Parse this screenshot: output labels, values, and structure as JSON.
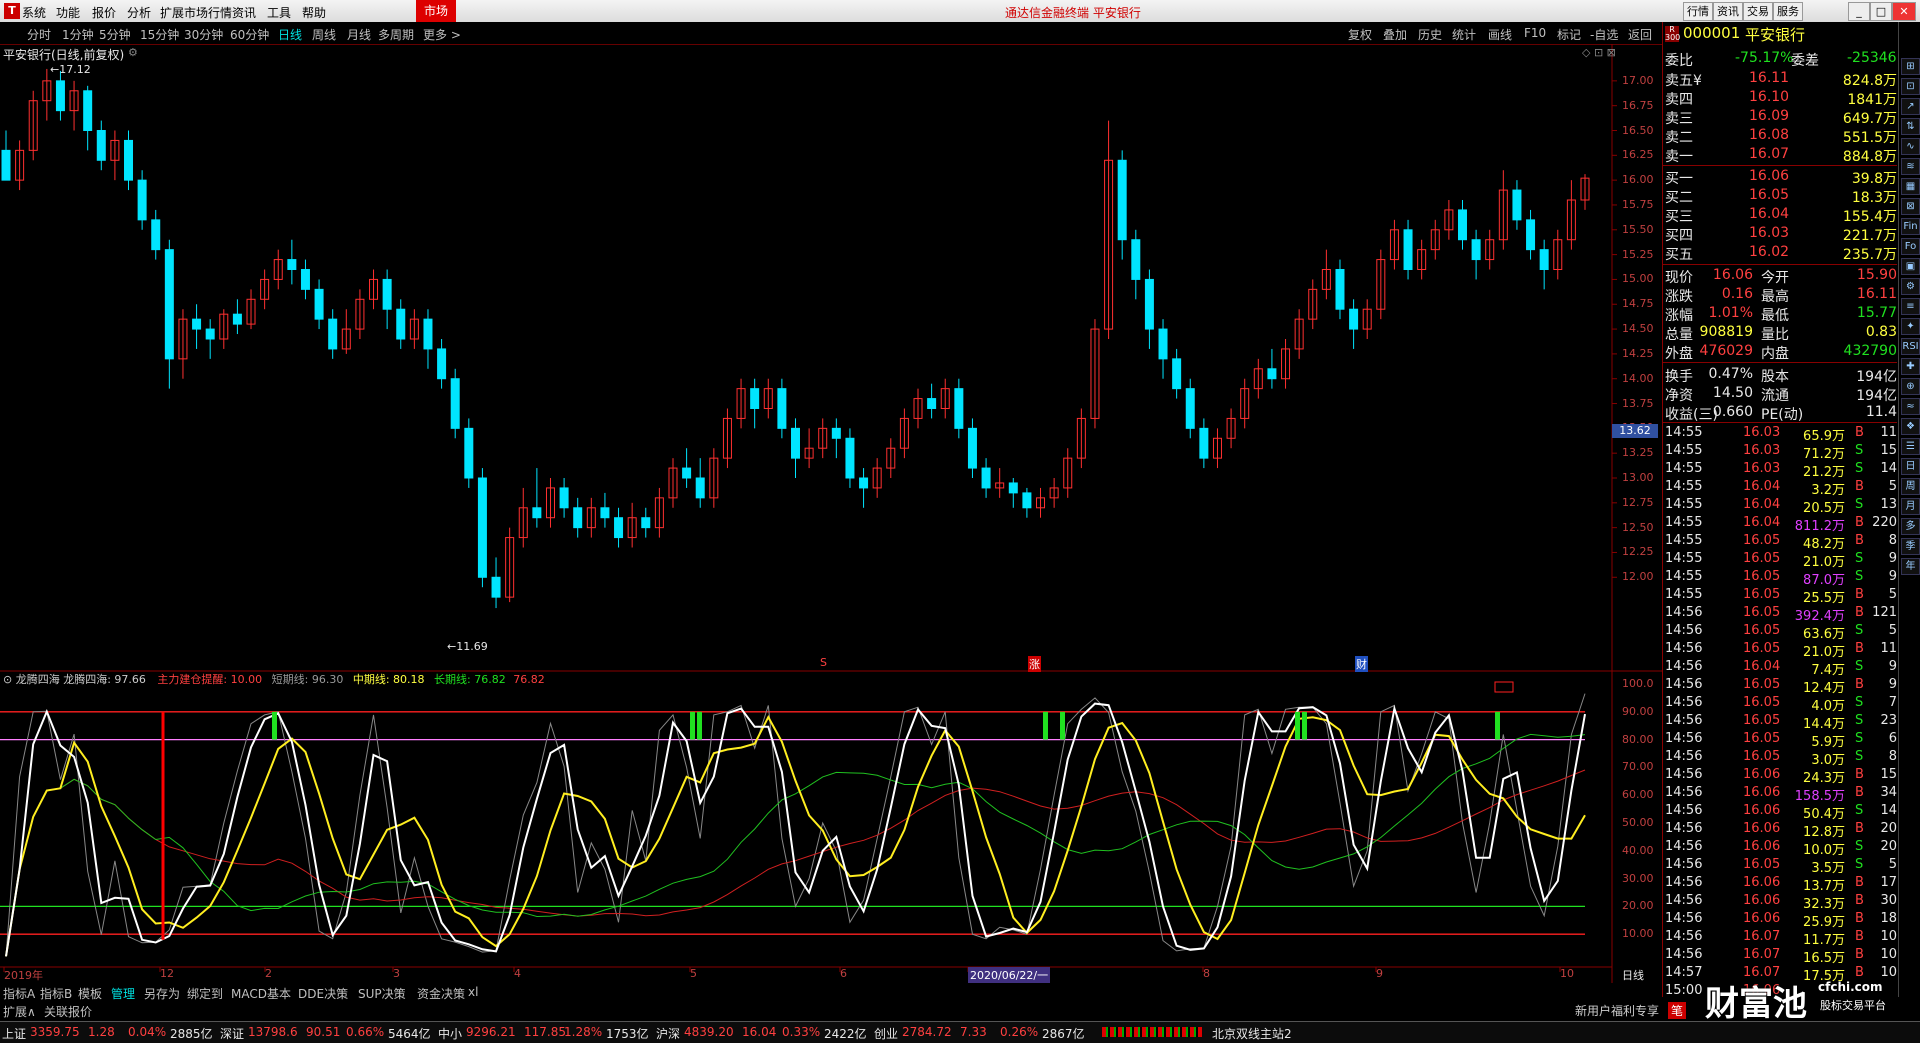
{
  "menu": {
    "items": [
      "系统",
      "功能",
      "报价",
      "分析",
      "扩展市场行情",
      "资讯",
      "工具",
      "帮助"
    ],
    "market": "市场",
    "title": "通达信金融终端  平安银行",
    "right_btns": [
      "行情",
      "资讯",
      "交易",
      "服务"
    ]
  },
  "periods": {
    "items": [
      "分时",
      "1分钟",
      "5分钟",
      "15分钟",
      "30分钟",
      "60分钟",
      "日线",
      "周线",
      "月线",
      "多周期",
      "更多 >"
    ],
    "active_index": 6
  },
  "tools": [
    "复权",
    "叠加",
    "历史",
    "统计",
    "画线",
    "F10",
    "标记",
    "-自选",
    "返回"
  ],
  "chart": {
    "title": "平安银行(日线,前复权)",
    "price_axis": [
      "17.00",
      "16.75",
      "16.50",
      "16.25",
      "16.00",
      "15.75",
      "15.50",
      "15.25",
      "15.00",
      "14.75",
      "14.50",
      "14.25",
      "14.00",
      "13.75",
      "13.50",
      "13.25",
      "13.00",
      "12.75",
      "12.50",
      "12.25",
      "12.00"
    ],
    "high_marker": "17.12",
    "low_marker": "11.69",
    "cursor_price": "13.62",
    "event_marks": [
      "S",
      "涨",
      "财"
    ],
    "candles": [
      [
        16.3,
        16.0,
        16.5,
        16.0
      ],
      [
        16.0,
        16.3,
        16.4,
        15.9
      ],
      [
        16.3,
        16.8,
        16.9,
        16.2
      ],
      [
        16.8,
        17.0,
        17.12,
        16.6
      ],
      [
        17.0,
        16.7,
        17.1,
        16.6
      ],
      [
        16.7,
        16.9,
        17.0,
        16.5
      ],
      [
        16.9,
        16.5,
        16.95,
        16.3
      ],
      [
        16.5,
        16.2,
        16.6,
        16.1
      ],
      [
        16.2,
        16.4,
        16.5,
        16.0
      ],
      [
        16.4,
        16.0,
        16.5,
        15.9
      ],
      [
        16.0,
        15.6,
        16.1,
        15.5
      ],
      [
        15.6,
        15.3,
        15.7,
        15.2
      ],
      [
        15.3,
        14.2,
        15.4,
        13.9
      ],
      [
        14.2,
        14.6,
        14.7,
        14.0
      ],
      [
        14.6,
        14.5,
        14.75,
        14.3
      ],
      [
        14.5,
        14.4,
        14.6,
        14.2
      ],
      [
        14.4,
        14.65,
        14.7,
        14.3
      ],
      [
        14.65,
        14.55,
        14.8,
        14.45
      ],
      [
        14.55,
        14.8,
        14.9,
        14.5
      ],
      [
        14.8,
        15.0,
        15.1,
        14.7
      ],
      [
        15.0,
        15.2,
        15.3,
        14.9
      ],
      [
        15.2,
        15.1,
        15.4,
        14.95
      ],
      [
        15.1,
        14.9,
        15.2,
        14.8
      ],
      [
        14.9,
        14.6,
        15.0,
        14.5
      ],
      [
        14.6,
        14.3,
        14.7,
        14.2
      ],
      [
        14.3,
        14.5,
        14.7,
        14.25
      ],
      [
        14.5,
        14.8,
        14.9,
        14.4
      ],
      [
        14.8,
        15.0,
        15.1,
        14.7
      ],
      [
        15.0,
        14.7,
        15.1,
        14.5
      ],
      [
        14.7,
        14.4,
        14.8,
        14.3
      ],
      [
        14.4,
        14.6,
        14.7,
        14.3
      ],
      [
        14.6,
        14.3,
        14.7,
        14.1
      ],
      [
        14.3,
        14.0,
        14.4,
        13.9
      ],
      [
        14.0,
        13.5,
        14.1,
        13.4
      ],
      [
        13.5,
        13.0,
        13.6,
        12.9
      ],
      [
        13.0,
        12.0,
        13.1,
        11.9
      ],
      [
        12.0,
        11.8,
        12.2,
        11.69
      ],
      [
        11.8,
        12.4,
        12.5,
        11.75
      ],
      [
        12.4,
        12.7,
        12.9,
        12.3
      ],
      [
        12.7,
        12.6,
        13.1,
        12.5
      ],
      [
        12.6,
        12.9,
        13.0,
        12.5
      ],
      [
        12.9,
        12.7,
        13.0,
        12.6
      ],
      [
        12.7,
        12.5,
        12.8,
        12.4
      ],
      [
        12.5,
        12.7,
        12.8,
        12.4
      ],
      [
        12.7,
        12.6,
        12.85,
        12.5
      ],
      [
        12.6,
        12.4,
        12.7,
        12.3
      ],
      [
        12.4,
        12.6,
        12.75,
        12.3
      ],
      [
        12.6,
        12.5,
        12.7,
        12.4
      ],
      [
        12.5,
        12.8,
        12.9,
        12.4
      ],
      [
        12.8,
        13.1,
        13.2,
        12.7
      ],
      [
        13.1,
        13.0,
        13.3,
        12.9
      ],
      [
        13.0,
        12.8,
        13.2,
        12.7
      ],
      [
        12.8,
        13.2,
        13.3,
        12.7
      ],
      [
        13.2,
        13.6,
        13.7,
        13.1
      ],
      [
        13.6,
        13.9,
        14.0,
        13.5
      ],
      [
        13.9,
        13.7,
        14.0,
        13.5
      ],
      [
        13.7,
        13.9,
        14.0,
        13.6
      ],
      [
        13.9,
        13.5,
        14.0,
        13.4
      ],
      [
        13.5,
        13.2,
        13.6,
        13.0
      ],
      [
        13.2,
        13.3,
        13.5,
        13.1
      ],
      [
        13.3,
        13.5,
        13.6,
        13.2
      ],
      [
        13.5,
        13.4,
        13.6,
        13.2
      ],
      [
        13.4,
        13.0,
        13.5,
        12.9
      ],
      [
        13.0,
        12.9,
        13.1,
        12.7
      ],
      [
        12.9,
        13.1,
        13.2,
        12.8
      ],
      [
        13.1,
        13.3,
        13.4,
        13.0
      ],
      [
        13.3,
        13.6,
        13.7,
        13.2
      ],
      [
        13.6,
        13.8,
        13.9,
        13.5
      ],
      [
        13.8,
        13.7,
        13.95,
        13.6
      ],
      [
        13.7,
        13.9,
        14.0,
        13.6
      ],
      [
        13.9,
        13.5,
        14.0,
        13.4
      ],
      [
        13.5,
        13.1,
        13.6,
        13.0
      ],
      [
        13.1,
        12.9,
        13.2,
        12.8
      ],
      [
        12.9,
        12.95,
        13.1,
        12.8
      ],
      [
        12.95,
        12.85,
        13.0,
        12.7
      ],
      [
        12.85,
        12.7,
        12.9,
        12.6
      ],
      [
        12.7,
        12.8,
        12.9,
        12.6
      ],
      [
        12.8,
        12.9,
        13.0,
        12.7
      ],
      [
        12.9,
        13.2,
        13.3,
        12.8
      ],
      [
        13.2,
        13.6,
        13.7,
        13.1
      ],
      [
        13.6,
        14.5,
        14.6,
        13.5
      ],
      [
        14.5,
        16.2,
        16.6,
        14.4
      ],
      [
        16.2,
        15.4,
        16.3,
        15.2
      ],
      [
        15.4,
        15.0,
        15.5,
        14.8
      ],
      [
        15.0,
        14.5,
        15.1,
        14.3
      ],
      [
        14.5,
        14.2,
        14.6,
        14.0
      ],
      [
        14.2,
        13.9,
        14.3,
        13.8
      ],
      [
        13.9,
        13.5,
        14.0,
        13.4
      ],
      [
        13.5,
        13.2,
        13.6,
        13.1
      ],
      [
        13.2,
        13.4,
        13.5,
        13.1
      ],
      [
        13.4,
        13.6,
        13.7,
        13.3
      ],
      [
        13.6,
        13.9,
        14.0,
        13.5
      ],
      [
        13.9,
        14.1,
        14.2,
        13.8
      ],
      [
        14.1,
        14.0,
        14.3,
        13.9
      ],
      [
        14.0,
        14.3,
        14.4,
        13.9
      ],
      [
        14.3,
        14.6,
        14.7,
        14.2
      ],
      [
        14.6,
        14.9,
        15.0,
        14.5
      ],
      [
        14.9,
        15.1,
        15.3,
        14.8
      ],
      [
        15.1,
        14.7,
        15.2,
        14.6
      ],
      [
        14.7,
        14.5,
        14.8,
        14.3
      ],
      [
        14.5,
        14.7,
        14.8,
        14.4
      ],
      [
        14.7,
        15.2,
        15.3,
        14.6
      ],
      [
        15.2,
        15.5,
        15.6,
        15.1
      ],
      [
        15.5,
        15.1,
        15.6,
        15.0
      ],
      [
        15.1,
        15.3,
        15.4,
        15.0
      ],
      [
        15.3,
        15.5,
        15.6,
        15.2
      ],
      [
        15.5,
        15.7,
        15.8,
        15.4
      ],
      [
        15.7,
        15.4,
        15.8,
        15.3
      ],
      [
        15.4,
        15.2,
        15.5,
        15.0
      ],
      [
        15.2,
        15.4,
        15.5,
        15.1
      ],
      [
        15.4,
        15.9,
        16.1,
        15.3
      ],
      [
        15.9,
        15.6,
        16.0,
        15.5
      ],
      [
        15.6,
        15.3,
        15.7,
        15.2
      ],
      [
        15.3,
        15.1,
        15.4,
        14.9
      ],
      [
        15.1,
        15.4,
        15.5,
        15.0
      ],
      [
        15.4,
        15.8,
        16.0,
        15.3
      ],
      [
        15.8,
        16.02,
        16.06,
        15.7
      ]
    ],
    "indicator": {
      "name": "龙腾四海",
      "value_label": "龙腾四海: 97.66",
      "main_label": "主力建仓提醒: 10.00",
      "short_label": "短期线: 96.30",
      "mid_label": "中期线: 80.18",
      "long_label": "长期线: 76.82",
      "long_label2": "76.82",
      "axis": [
        "100.0",
        "90.00",
        "80.00",
        "70.00",
        "60.00",
        "50.00",
        "40.00",
        "30.00",
        "20.00",
        "10.00"
      ],
      "refs": [
        90,
        80,
        20,
        10
      ]
    },
    "time_axis": [
      "2019年",
      "12",
      "2",
      "3",
      "4",
      "5",
      "6",
      "2020/06/22/一",
      "8",
      "9",
      "10"
    ],
    "period_label": "日线"
  },
  "quote": {
    "code": "000001",
    "name": "平安银行",
    "badge": "R 300",
    "wb_label": "委比",
    "wb": "-75.17%",
    "wc_label": "委差",
    "wc": "-25346",
    "asks": [
      [
        "卖五¥",
        "16.11",
        "824.8万"
      ],
      [
        "卖四",
        "16.10",
        "1841万"
      ],
      [
        "卖三",
        "16.09",
        "649.7万"
      ],
      [
        "卖二",
        "16.08",
        "551.5万"
      ],
      [
        "卖一",
        "16.07",
        "884.8万"
      ]
    ],
    "bids": [
      [
        "买一",
        "16.06",
        "39.8万"
      ],
      [
        "买二",
        "16.05",
        "18.3万"
      ],
      [
        "买三",
        "16.04",
        "155.4万"
      ],
      [
        "买四",
        "16.03",
        "221.7万"
      ],
      [
        "买五",
        "16.02",
        "235.7万"
      ]
    ],
    "stats": [
      [
        "现价",
        "16.06",
        "今开",
        "15.90"
      ],
      [
        "涨跌",
        "0.16",
        "最高",
        "16.11"
      ],
      [
        "涨幅",
        "1.01%",
        "最低",
        "15.77"
      ],
      [
        "总量",
        "908819",
        "量比",
        "0.83"
      ],
      [
        "外盘",
        "476029",
        "内盘",
        "432790"
      ],
      [
        "换手",
        "0.47%",
        "股本",
        "194亿"
      ],
      [
        "净资",
        "14.50",
        "流通",
        "194亿"
      ],
      [
        "收益(三)",
        "0.660",
        "PE(动)",
        "11.4"
      ]
    ],
    "ticks": [
      [
        "14:55",
        "16.03",
        "65.9万",
        "B",
        "11"
      ],
      [
        "14:55",
        "16.03",
        "71.2万",
        "S",
        "15"
      ],
      [
        "14:55",
        "16.03",
        "21.2万",
        "S",
        "14"
      ],
      [
        "14:55",
        "16.04",
        "3.2万",
        "B",
        "5"
      ],
      [
        "14:55",
        "16.04",
        "20.5万",
        "S",
        "13"
      ],
      [
        "14:55",
        "16.04",
        "811.2万",
        "B",
        "220"
      ],
      [
        "14:55",
        "16.05",
        "48.2万",
        "B",
        "8"
      ],
      [
        "14:55",
        "16.05",
        "21.0万",
        "S",
        "9"
      ],
      [
        "14:55",
        "16.05",
        "87.0万",
        "S",
        "9"
      ],
      [
        "14:55",
        "16.05",
        "25.5万",
        "B",
        "5"
      ],
      [
        "14:56",
        "16.05",
        "392.4万",
        "B",
        "121"
      ],
      [
        "14:56",
        "16.05",
        "63.6万",
        "S",
        "5"
      ],
      [
        "14:56",
        "16.05",
        "21.0万",
        "B",
        "11"
      ],
      [
        "14:56",
        "16.04",
        "7.4万",
        "S",
        "9"
      ],
      [
        "14:56",
        "16.05",
        "12.4万",
        "B",
        "9"
      ],
      [
        "14:56",
        "16.05",
        "4.0万",
        "S",
        "7"
      ],
      [
        "14:56",
        "16.05",
        "14.4万",
        "S",
        "23"
      ],
      [
        "14:56",
        "16.05",
        "5.9万",
        "S",
        "6"
      ],
      [
        "14:56",
        "16.05",
        "3.0万",
        "S",
        "8"
      ],
      [
        "14:56",
        "16.06",
        "24.3万",
        "B",
        "15"
      ],
      [
        "14:56",
        "16.06",
        "158.5万",
        "B",
        "34"
      ],
      [
        "14:56",
        "16.06",
        "50.4万",
        "S",
        "14"
      ],
      [
        "14:56",
        "16.06",
        "12.8万",
        "B",
        "20"
      ],
      [
        "14:56",
        "16.06",
        "10.0万",
        "S",
        "20"
      ],
      [
        "14:56",
        "16.05",
        "3.5万",
        "S",
        "5"
      ],
      [
        "14:56",
        "16.06",
        "13.7万",
        "B",
        "17"
      ],
      [
        "14:56",
        "16.06",
        "32.3万",
        "B",
        "30"
      ],
      [
        "14:56",
        "16.06",
        "25.9万",
        "B",
        "18"
      ],
      [
        "14:56",
        "16.07",
        "11.7万",
        "B",
        "10"
      ],
      [
        "14:56",
        "16.07",
        "16.5万",
        "B",
        "10"
      ],
      [
        "14:57",
        "16.07",
        "17.5万",
        "B",
        "10"
      ],
      [
        "15:00",
        "16.06",
        "",
        "",
        ""
      ]
    ]
  },
  "sidebar_icons": [
    "⊞",
    "⊡",
    "↗",
    "⇅",
    "∿",
    "≋",
    "▦",
    "⊠",
    "Fin",
    "Fo",
    "▣",
    "⚙",
    "≡",
    "✦",
    "RSI",
    "✚",
    "⊕",
    "≈",
    "❖",
    "☰",
    "日",
    "周",
    "月",
    "多",
    "季",
    "年"
  ],
  "bottom_tabs": [
    "指标A",
    "指标B",
    "模板",
    "管理",
    "另存为",
    "绑定到",
    "MACD基本",
    "DDE决策",
    "SUP决策",
    "资金决策",
    "xl"
  ],
  "bottom_active": 3,
  "ext_tabs": [
    "扩展∧",
    "关联报价"
  ],
  "promo": "新用户福利专享",
  "watermark": "财富池",
  "watermark_url": "cfchi.com",
  "watermark_sub": "股标交易平台",
  "status": {
    "items": [
      [
        "上证",
        "3359.75",
        "1.28",
        "0.04%",
        "2885亿"
      ],
      [
        "深证",
        "13798.6",
        "90.51",
        "0.66%",
        "5464亿"
      ],
      [
        "中小",
        "9296.21",
        "117.85",
        "1.28%",
        "1753亿"
      ],
      [
        "沪深",
        "4839.20",
        "16.04",
        "0.33%",
        "2422亿"
      ],
      [
        "创业",
        "2784.72",
        "7.33",
        "0.26%",
        "2867亿"
      ]
    ],
    "server": "北京双线主站2"
  }
}
